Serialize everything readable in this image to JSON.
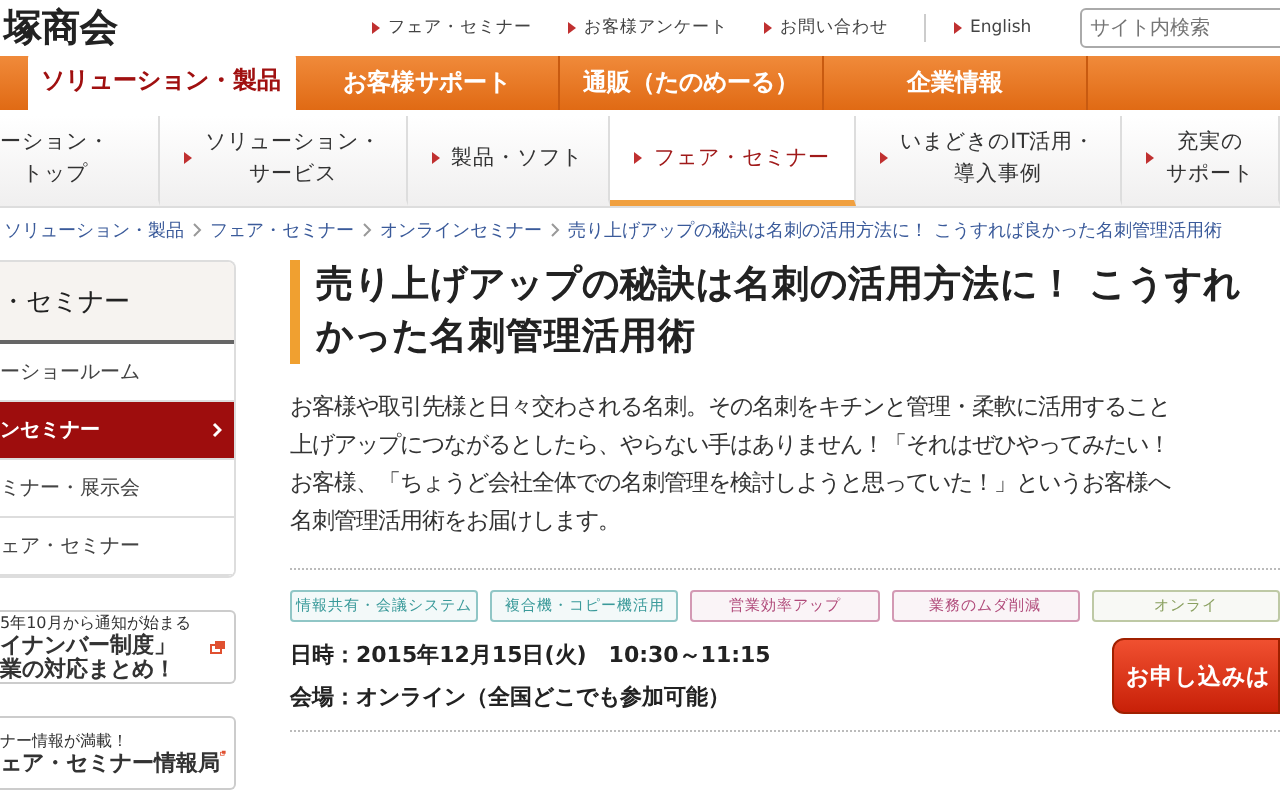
{
  "header": {
    "logo": "塚商会",
    "links": [
      "フェア・セミナー",
      "お客様アンケート",
      "お問い合わせ"
    ],
    "language_link": "English",
    "search": {
      "placeholder": "サイト内検索"
    }
  },
  "main_nav": [
    {
      "label": "ソリューション・製品",
      "selected": true
    },
    {
      "label": "お客様サポート",
      "selected": false
    },
    {
      "label": "通販（たのめーる）",
      "selected": false
    },
    {
      "label": "企業情報",
      "selected": false
    }
  ],
  "sub_nav": [
    {
      "lines": [
        "ーション・",
        "トップ"
      ],
      "selected": false
    },
    {
      "lines": [
        "ソリューション・",
        "サービス"
      ],
      "selected": false
    },
    {
      "lines": [
        "製品・ソフト"
      ],
      "selected": false
    },
    {
      "lines": [
        "フェア・セミナー"
      ],
      "selected": true
    },
    {
      "lines": [
        "いまどきのIT活用・",
        "導入事例"
      ],
      "selected": false
    },
    {
      "lines": [
        "充実の",
        "サポート"
      ],
      "selected": false
    }
  ],
  "breadcrumb": [
    "ソリューション・製品",
    "フェア・セミナー",
    "オンラインセミナー",
    "売り上げアップの秘訣は名刺の活用方法に！ こうすれば良かった名刺管理活用術"
  ],
  "sidebar": {
    "title": "・セミナー",
    "items": [
      {
        "label": "ーショールーム",
        "selected": false
      },
      {
        "label": "ンセミナー",
        "selected": true
      },
      {
        "label": "ミナー・展示会",
        "selected": false
      },
      {
        "label": "ェア・セミナー",
        "selected": false
      }
    ],
    "banners": [
      {
        "lines": [
          "5年10月から通知が始まる",
          "イナンバー制度」",
          "業の対応まとめ！"
        ]
      },
      {
        "lines": [
          "ナー情報が満載！",
          "ェア・セミナー情報局"
        ]
      }
    ]
  },
  "article": {
    "title_lines": [
      "売り上げアップの秘訣は名刺の活用方法に！ こうすれ",
      "かった名刺管理活用術"
    ],
    "body_lines": [
      "お客様や取引先様と日々交わされる名刺。その名刺をキチンと管理・柔軟に活用すること",
      "上げアップにつながるとしたら、やらない手はありません！「それはぜひやってみたい！",
      "お客様、「ちょうど会社全体での名刺管理を検討しようと思っていた！」というお客様へ",
      "名刺管理活用術をお届けします。"
    ],
    "tags": [
      {
        "label": "情報共有・会議システム",
        "color": "#3a9a9a"
      },
      {
        "label": "複合機・コピー機活用",
        "color": "#3a9a9a"
      },
      {
        "label": "営業効率アップ",
        "color": "#b04a7a"
      },
      {
        "label": "業務のムダ削減",
        "color": "#b04a7a"
      },
      {
        "label": "オンライ",
        "color": "#8aa060"
      }
    ],
    "date": "日時：2015年12月15日(火)　10:30～11:15",
    "venue": "会場：オンライン（全国どこでも参加可能）",
    "apply_button": "お申し込みは"
  }
}
